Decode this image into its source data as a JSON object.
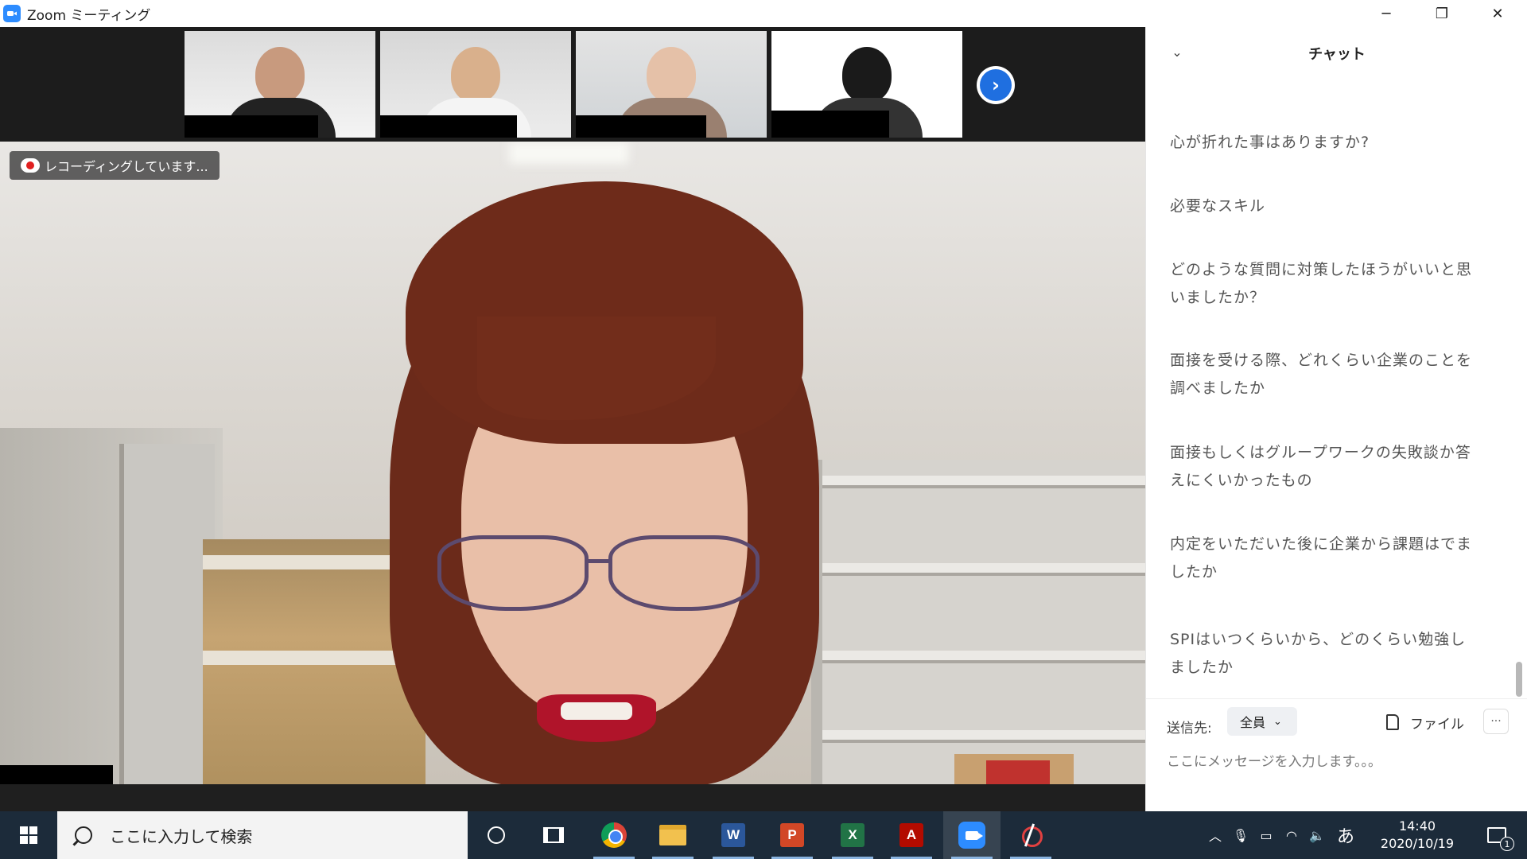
{
  "window": {
    "title": "Zoom ミーティング",
    "minimize_icon": "minimize-icon",
    "maximize_icon": "restore-icon",
    "close_icon": "close-icon"
  },
  "meeting": {
    "recording_status": "レコーディングしています...",
    "thumbnails": [
      {
        "participant": "participant-1"
      },
      {
        "participant": "participant-2"
      },
      {
        "participant": "participant-3"
      },
      {
        "participant": "participant-4"
      }
    ],
    "next_page_icon": "chevron-right-icon"
  },
  "chat": {
    "title": "チャット",
    "collapse_icon": "chevron-down-icon",
    "messages": [
      "心が折れた事はありますか?",
      "必要なスキル",
      "どのような質問に対策したほうがいいと思いましたか？",
      "面接を受ける際、どれくらい企業のことを調べましたか",
      "面接もしくはグループワークの失敗談か答えにくいかったもの",
      "内定をいただいた後に企業から課題はでましたか",
      "SPIはいつくらいから、どのくらい勉強しましたか"
    ],
    "send_to_label": "送信先:",
    "recipient": "全員",
    "file_label": "ファイル",
    "more_label": "···",
    "input_placeholder": "ここにメッセージを入力します。。。"
  },
  "taskbar": {
    "search_placeholder": "ここに入力して検索",
    "ime_label": "あ",
    "time": "14:40",
    "date": "2020/10/19",
    "notification_count": "1",
    "apps": [
      "cortana-icon",
      "task-view-icon",
      "chrome-icon",
      "file-explorer-icon",
      "word-icon",
      "powerpoint-icon",
      "excel-icon",
      "acrobat-icon",
      "zoom-icon",
      "snipping-tool-icon"
    ]
  },
  "colors": {
    "zoom_blue": "#2d8cff",
    "taskbar_bg": "#1c2b3a",
    "recording_red": "#e02020"
  }
}
